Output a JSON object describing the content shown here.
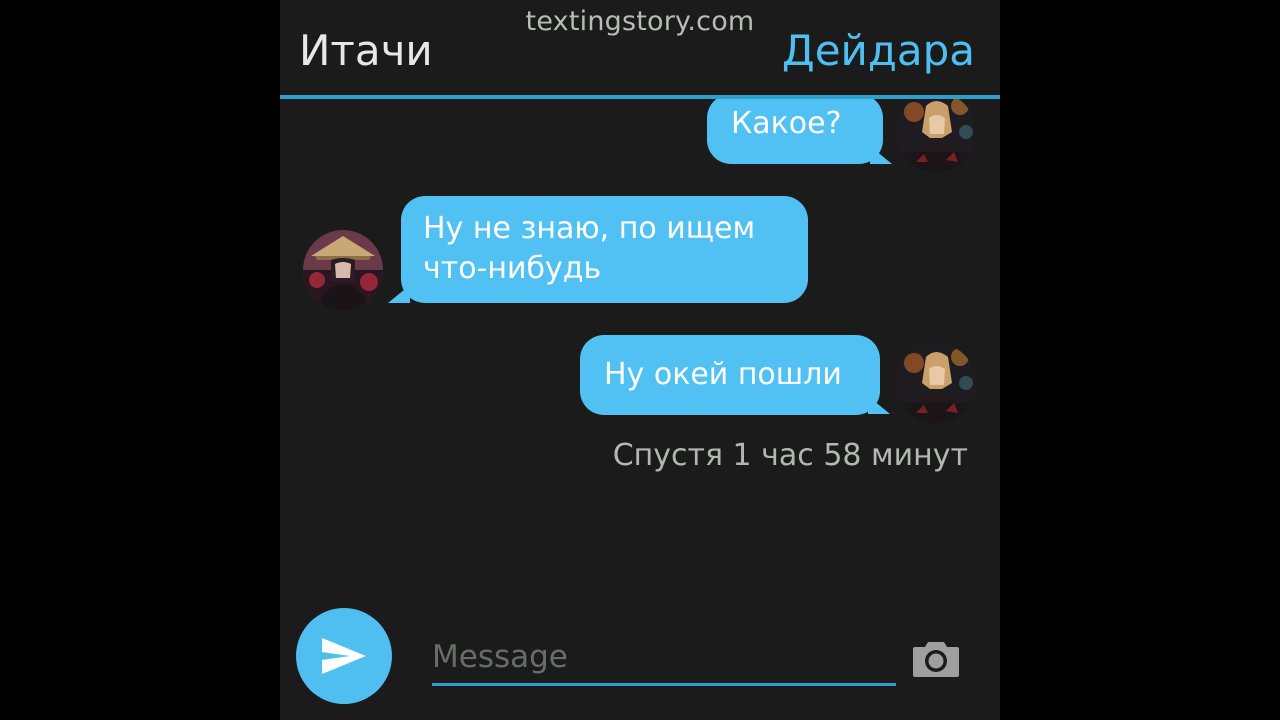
{
  "header": {
    "watermark": "textingstory.com",
    "left_contact": "Итачи",
    "right_contact": "Дейдара"
  },
  "messages": [
    {
      "side": "right",
      "sender": "Дейдара",
      "text_lines": [
        "Какое?"
      ]
    },
    {
      "side": "left",
      "sender": "Итачи",
      "text_lines": [
        "Ну не знаю, по ищем",
        "что-нибудь"
      ]
    },
    {
      "side": "right",
      "sender": "Дейдара",
      "text_lines": [
        "Ну окей пошли"
      ]
    }
  ],
  "timestamp": "Спустя 1 час 58 минут",
  "input": {
    "placeholder": "Message",
    "value": ""
  },
  "icons": {
    "send": "send-icon",
    "camera": "camera-icon"
  },
  "colors": {
    "accent": "#4ebff0",
    "bubble": "#50c1f2",
    "background": "#1a1b1a",
    "divider": "#2c9fcd"
  }
}
